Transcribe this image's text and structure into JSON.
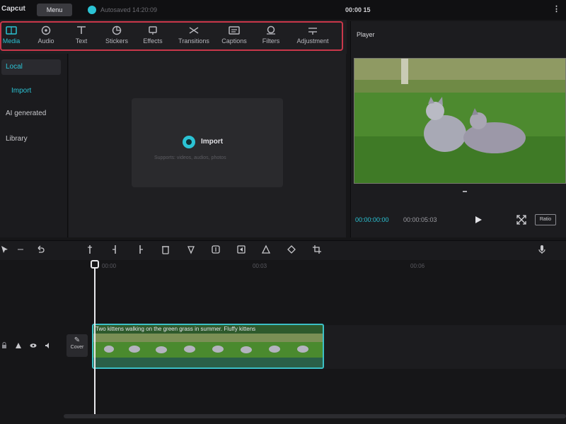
{
  "window": {
    "app_name": "Capcut",
    "menu_label": "Menu",
    "project_name": "Autosaved 14:20:09",
    "top_time": "00:00 15",
    "more_label": "⋮"
  },
  "toolbar": {
    "items": [
      {
        "label": "Media",
        "icon": "media-icon",
        "active": true
      },
      {
        "label": "Audio",
        "icon": "audio-icon",
        "active": false
      },
      {
        "label": "Text",
        "icon": "text-icon",
        "active": false
      },
      {
        "label": "Stickers",
        "icon": "stickers-icon",
        "active": false
      },
      {
        "label": "Effects",
        "icon": "effects-icon",
        "active": false
      },
      {
        "label": "Transitions",
        "icon": "transitions-icon",
        "active": false
      },
      {
        "label": "Captions",
        "icon": "captions-icon",
        "active": false
      },
      {
        "label": "Filters",
        "icon": "filters-icon",
        "active": false
      },
      {
        "label": "Adjustment",
        "icon": "adjustment-icon",
        "active": false
      }
    ],
    "accent_color": "#2bc3d4",
    "highlight_color": "#c9374a"
  },
  "sidebar": {
    "items": [
      {
        "label": "Local",
        "selected": true,
        "sub": false
      },
      {
        "label": "Import",
        "selected": false,
        "sub": true
      },
      {
        "label": "AI generated",
        "selected": false,
        "sub": false
      },
      {
        "label": "Library",
        "selected": false,
        "sub": false
      }
    ]
  },
  "media": {
    "import_label": "Import",
    "import_hint": "Supports: videos, audios, photos"
  },
  "player": {
    "title": "Player",
    "current_time": "00:00:00:00",
    "total_time": "00:00:05:03",
    "ratio_label": "Ratio"
  },
  "timeline": {
    "ruler": [
      "00:00",
      "00:03",
      "00:06"
    ],
    "cover_label": "Cover",
    "clip_title": "Two kittens walking on the green grass in summer. Fluffy kittens",
    "track_icons": [
      "lock-icon",
      "eye-icon",
      "audio-icon"
    ]
  }
}
